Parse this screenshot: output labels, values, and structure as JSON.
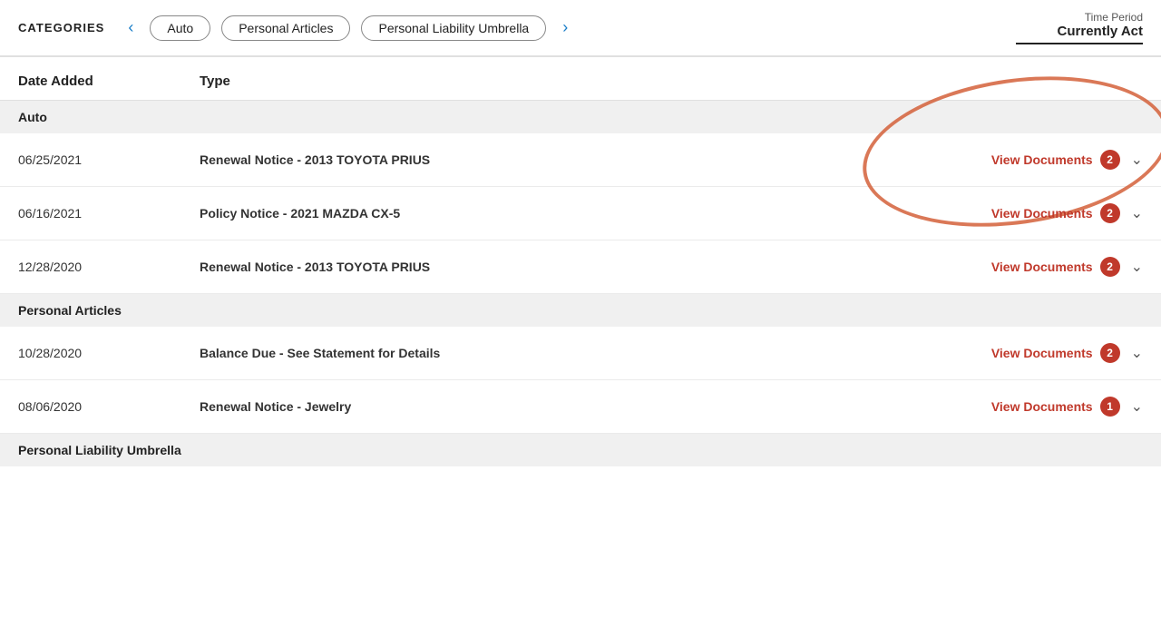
{
  "header": {
    "categories_label": "CATEGORIES",
    "tabs": [
      {
        "id": "auto",
        "label": "Auto"
      },
      {
        "id": "personal-articles",
        "label": "Personal Articles"
      },
      {
        "id": "personal-liability-umbrella",
        "label": "Personal Liability Umbrella"
      }
    ],
    "time_period_label": "Time Period",
    "time_period_value": "Currently Act"
  },
  "table": {
    "col_date": "Date Added",
    "col_type": "Type",
    "sections": [
      {
        "name": "Auto",
        "rows": [
          {
            "date": "06/25/2021",
            "type": "Renewal Notice - 2013 TOYOTA PRIUS",
            "action": "View Documents",
            "badge": "2",
            "has_circle": true
          },
          {
            "date": "06/16/2021",
            "type": "Policy Notice - 2021 MAZDA CX-5",
            "action": "View Documents",
            "badge": "2",
            "has_circle": false
          },
          {
            "date": "12/28/2020",
            "type": "Renewal Notice - 2013 TOYOTA PRIUS",
            "action": "View Documents",
            "badge": "2",
            "has_circle": false
          }
        ]
      },
      {
        "name": "Personal Articles",
        "rows": [
          {
            "date": "10/28/2020",
            "type": "Balance Due - See Statement for Details",
            "action": "View Documents",
            "badge": "2",
            "has_circle": false
          },
          {
            "date": "08/06/2020",
            "type": "Renewal Notice - Jewelry",
            "action": "View Documents",
            "badge": "1",
            "has_circle": false
          }
        ]
      },
      {
        "name": "Personal Liability Umbrella",
        "rows": []
      }
    ]
  },
  "icons": {
    "chevron_left": "‹",
    "chevron_right": "›",
    "chevron_down": "∨"
  }
}
